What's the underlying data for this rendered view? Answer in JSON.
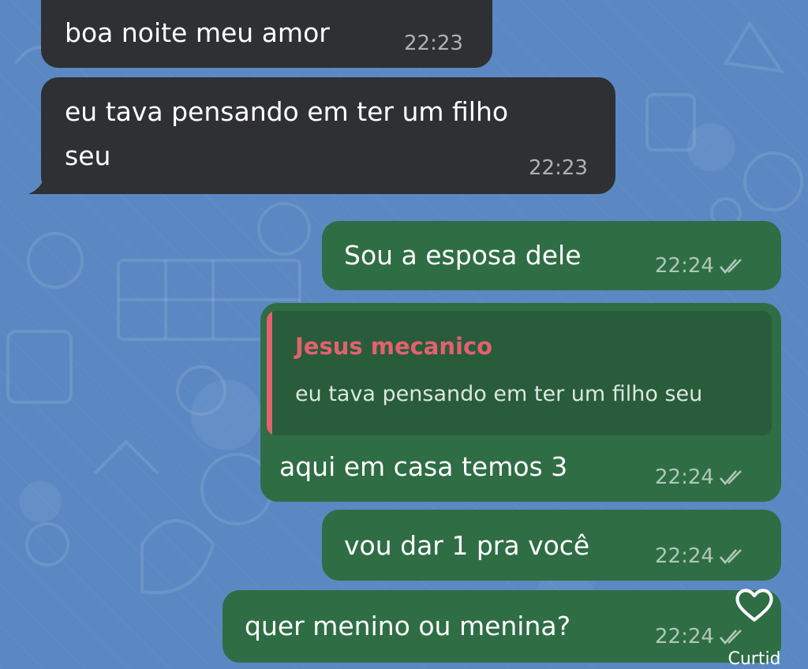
{
  "colors": {
    "wallpaper": "#5b88c2",
    "incoming_bubble": "#2f3033",
    "outgoing_bubble": "#2f6d45",
    "reply_accent": "#e4616e"
  },
  "messages": [
    {
      "direction": "incoming",
      "text": "boa noite meu amor",
      "time": "22:23"
    },
    {
      "direction": "incoming",
      "line1": "eu tava pensando em ter um filho",
      "line2": "seu",
      "time": "22:23"
    },
    {
      "direction": "outgoing",
      "text": "Sou a esposa dele",
      "time": "22:24",
      "status_icon": "double-check-icon"
    },
    {
      "direction": "outgoing",
      "reply": {
        "name": "Jesus mecanico",
        "text": "eu tava pensando em ter um filho seu"
      },
      "text": "aqui em casa temos 3",
      "time": "22:24",
      "status_icon": "double-check-icon"
    },
    {
      "direction": "outgoing",
      "text": "vou dar 1 pra você",
      "time": "22:24",
      "status_icon": "double-check-icon"
    },
    {
      "direction": "outgoing",
      "text": "quer menino ou menina?",
      "time": "22:24",
      "status_icon": "double-check-icon"
    }
  ],
  "reaction": {
    "icon": "heart-outline-icon",
    "label": "Curtid"
  }
}
